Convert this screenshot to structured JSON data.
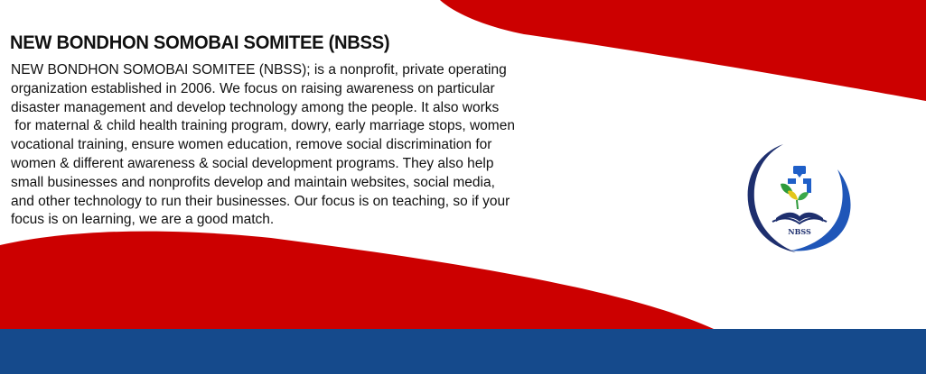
{
  "banner": {
    "title": "NEW BONDHON SOMOBAI SOMITEE (NBSS)",
    "body_lines": [
      "NEW BONDHON SOMOBAI SOMITEE (NBSS); is a nonprofit, private operating",
      "organization established in 2006. We focus on raising awareness on particular",
      "disaster management and develop technology among the people. It also works",
      " for maternal & child health training program, dowry, early marriage stops, women",
      "vocational training, ensure women education, remove social discrimination for",
      "women & different awareness & social development programs. They also help",
      "small businesses and nonprofits develop and maintain websites, social media,",
      "and other technology to run their businesses. Our focus is on teaching, so if your",
      "focus is on learning, we are a good match."
    ]
  },
  "logo": {
    "text": "NBSS",
    "icons": [
      "book-icon",
      "leaf-icon",
      "figure-icon"
    ]
  },
  "colors": {
    "red": "#cc0000",
    "blue": "#154a8c",
    "text": "#111111",
    "logo_navy": "#1e2f6e"
  }
}
